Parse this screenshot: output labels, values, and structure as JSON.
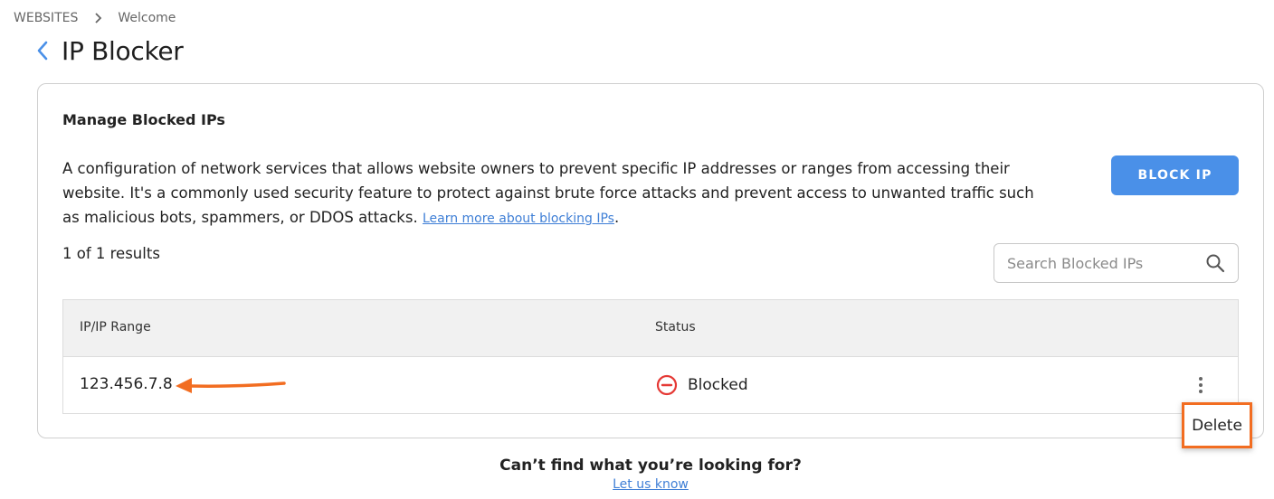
{
  "breadcrumb": {
    "items": [
      "WEBSITES",
      "Welcome"
    ]
  },
  "page": {
    "title": "IP Blocker"
  },
  "card": {
    "title": "Manage Blocked IPs",
    "description": "A configuration of network services that allows website owners to prevent specific IP addresses or ranges from accessing their website. It's a commonly used security feature to protect against brute force attacks and prevent access to unwanted traffic such as malicious bots, spammers, or DDOS attacks.",
    "learn_more": "Learn more about blocking IPs",
    "learn_more_suffix": ".",
    "block_button": "BLOCK IP",
    "results": "1 of 1 results",
    "search_placeholder": "Search Blocked IPs"
  },
  "table": {
    "columns": [
      "IP/IP Range",
      "Status"
    ],
    "rows": [
      {
        "ip": "123.456.7.8",
        "status": "Blocked"
      }
    ]
  },
  "row_menu": {
    "delete": "Delete"
  },
  "footer": {
    "question": "Can’t find what you’re looking for?",
    "link": "Let us know"
  },
  "colors": {
    "accent": "#4a90e8",
    "blocked": "#e53935",
    "highlight": "#f26d21"
  },
  "icons": [
    "chevron-right-icon",
    "back-chevron-icon",
    "search-icon",
    "blocked-icon",
    "kebab-menu-icon",
    "arrow-annotation"
  ]
}
